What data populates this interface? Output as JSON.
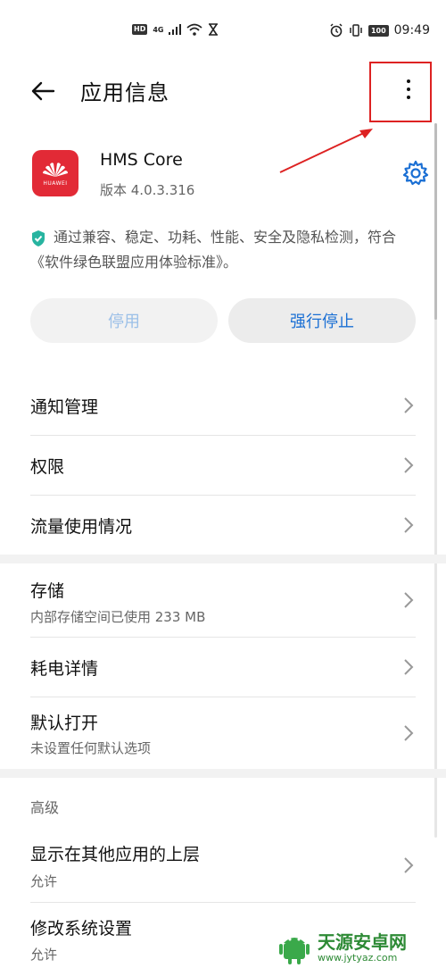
{
  "status_bar": {
    "hd_label": "HD",
    "network_label": "4G",
    "battery_level": "100",
    "time": "09:49"
  },
  "header": {
    "title": "应用信息"
  },
  "app": {
    "name": "HMS Core",
    "version": "版本 4.0.3.316",
    "icon_label": "HUAWEI"
  },
  "notice": {
    "text": "通过兼容、稳定、功耗、性能、安全及隐私检测，符合《软件绿色联盟应用体验标准》。"
  },
  "buttons": {
    "disable_label": "停用",
    "force_stop_label": "强行停止"
  },
  "section1": {
    "items": [
      {
        "label": "通知管理"
      },
      {
        "label": "权限"
      },
      {
        "label": "流量使用情况"
      }
    ]
  },
  "section2": {
    "items": [
      {
        "label": "存储",
        "sub": "内部存储空间已使用 233 MB"
      },
      {
        "label": "耗电详情"
      },
      {
        "label": "默认打开",
        "sub": "未设置任何默认选项"
      }
    ]
  },
  "section3": {
    "header": "高级",
    "items": [
      {
        "label": "显示在其他应用的上层",
        "sub": "允许"
      },
      {
        "label": "修改系统设置",
        "sub": "允许"
      }
    ]
  },
  "watermark": {
    "name": "天源安卓网",
    "url": "www.jytyaz.com"
  },
  "colors": {
    "accent": "#1a6fd4",
    "annotation": "#dd2222",
    "app_icon": "#e22a36"
  }
}
